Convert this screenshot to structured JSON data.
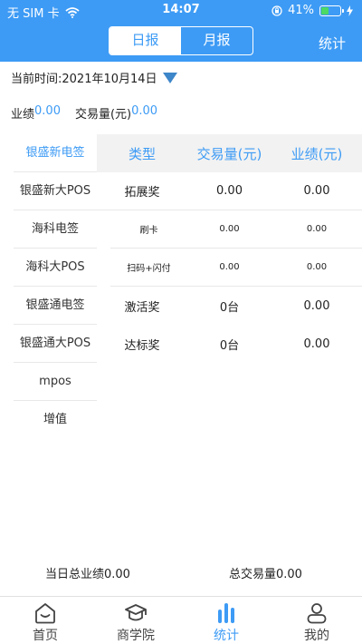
{
  "status_bar": {
    "carrier": "无 SIM 卡",
    "time": "14:07",
    "battery": "41%",
    "battery_level": 0.41
  },
  "nav": {
    "tabs": [
      {
        "label": "日报",
        "active": true
      },
      {
        "label": "月报",
        "active": false
      }
    ],
    "right_label": "统计"
  },
  "date": {
    "text": "当前时间:2021年10月14日"
  },
  "summary": {
    "perf_label": "业绩",
    "perf_value": "0.00",
    "tx_label": "交易量(元)",
    "tx_value": "0.00"
  },
  "products": [
    {
      "label": "银盛新电签",
      "active": true
    },
    {
      "label": "银盛新大POS",
      "active": false
    },
    {
      "label": "海科电签",
      "active": false
    },
    {
      "label": "海科大POS",
      "active": false
    },
    {
      "label": "银盛通电签",
      "active": false
    },
    {
      "label": "银盛通大POS",
      "active": false
    },
    {
      "label": "mpos",
      "active": false
    },
    {
      "label": "增值",
      "active": false
    }
  ],
  "table": {
    "headers": [
      "类型",
      "交易量(元)",
      "业绩(元)"
    ],
    "rows": [
      {
        "type": "拓展奖",
        "tx": "0.00",
        "perf": "0.00",
        "sub": false
      },
      {
        "type": "刷卡",
        "tx": "0.00",
        "perf": "0.00",
        "sub": true
      },
      {
        "type": "扫码+闪付",
        "tx": "0.00",
        "perf": "0.00",
        "sub": true
      },
      {
        "type": "激活奖",
        "tx": "0台",
        "perf": "0.00",
        "sub": false
      },
      {
        "type": "达标奖",
        "tx": "0台",
        "perf": "0.00",
        "sub": false
      }
    ]
  },
  "totals": {
    "day_total": "当日总业绩0.00",
    "tx_total": "总交易量0.00"
  },
  "tabbar": [
    {
      "label": "首页",
      "icon": "home-icon",
      "active": false
    },
    {
      "label": "商学院",
      "icon": "graduation-cap-icon",
      "active": false
    },
    {
      "label": "统计",
      "icon": "bar-chart-icon",
      "active": true
    },
    {
      "label": "我的",
      "icon": "user-icon",
      "active": false
    }
  ],
  "colors": {
    "primary": "#3d9bf5",
    "battery": "#4cd964"
  }
}
